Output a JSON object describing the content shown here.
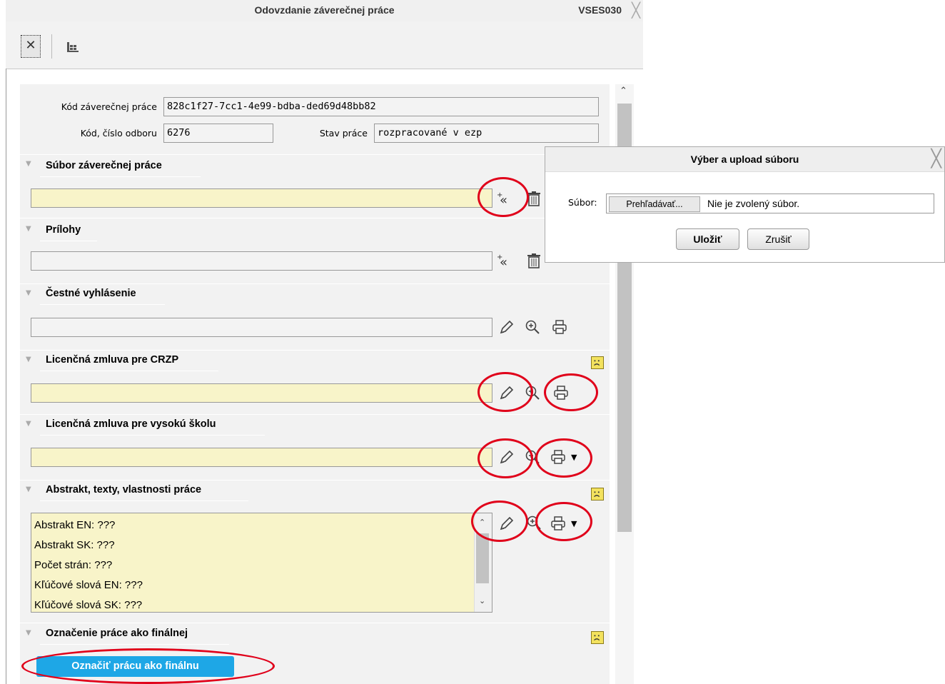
{
  "window": {
    "title": "Odovzdanie záverečnej práce",
    "code": "VSES030",
    "close_glyph": "╳"
  },
  "toolbar": {
    "close_icon": "close-icon",
    "table_icon": "table-icon"
  },
  "info": {
    "thesis_code_label": "Kód záverečnej práce",
    "thesis_code_value": "828c1f27-7cc1-4e99-bdba-ded69d48bb82",
    "dept_label": "Kód, číslo odboru",
    "dept_value": "6276",
    "status_label": "Stav práce",
    "status_value": "rozpracované v ezp"
  },
  "sections": {
    "file": {
      "title": "Súbor záverečnej práce"
    },
    "attachments": {
      "title": "Prílohy"
    },
    "declaration": {
      "title": "Čestné vyhlásenie"
    },
    "license_crzp": {
      "title": "Licenčná zmluva pre CRZP"
    },
    "license_school": {
      "title": "Licenčná zmluva pre vysokú školu"
    },
    "abstract": {
      "title": "Abstrakt, texty, vlastnosti práce",
      "lines": [
        "Abstrakt EN: ???",
        "Abstrakt SK: ???",
        "Počet strán: ???",
        "Kľúčové slová EN: ???",
        "Kľúčové slová SK: ???"
      ]
    },
    "final": {
      "title": "Označenie práce ako finálnej",
      "button": "Označiť prácu ako finálnu"
    }
  },
  "dialog": {
    "title": "Výber a upload súboru",
    "file_label": "Súbor:",
    "browse_button": "Prehľadávať...",
    "no_file_text": "Nie je zvolený súbor.",
    "save_button": "Uložiť",
    "cancel_button": "Zrušiť"
  },
  "colors": {
    "accent_button": "#1ea7e6",
    "required_field": "#f8f4c9",
    "annotation_circle": "#e0001a",
    "warning_smiley": "#f3e25e"
  }
}
